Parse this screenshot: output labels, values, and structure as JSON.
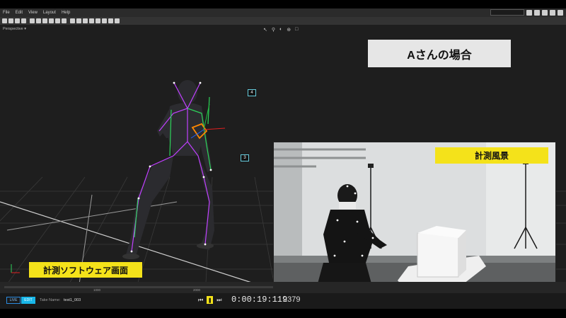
{
  "menu": {
    "items": [
      "File",
      "Edit",
      "View",
      "Layout",
      "Help"
    ]
  },
  "viewport": {
    "mode_label": "Perspective ▾",
    "markers": [
      "4",
      "3"
    ],
    "timeline_ticks": [
      "1000",
      "2000"
    ]
  },
  "overlay": {
    "title": "Aさんの場合",
    "software_label": "計測ソフトウェア画面",
    "scene_label": "計測風景"
  },
  "bottom": {
    "live_label": "LIVE",
    "edit_label": "EDIT",
    "take_name_label": "Take Name:",
    "take_name_value": "test1_003",
    "timecode": "0:00:19:119",
    "frame_count": "2379"
  },
  "colors": {
    "accent_yellow": "#f4e21a",
    "edit_blue": "#18b6e8",
    "viewport_bg": "#1e1e1e"
  }
}
